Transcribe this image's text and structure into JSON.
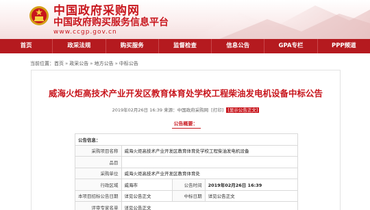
{
  "header": {
    "title": "中国政府采购网",
    "subtitle": "中国政府购买服务信息平台",
    "url": "www.ccgp.gov.cn",
    "emblem_icon": "national-emblem-icon",
    "brand_color": "#c8161d"
  },
  "nav": {
    "items": [
      {
        "label": "首页"
      },
      {
        "label": "政采法规"
      },
      {
        "label": "购买服务"
      },
      {
        "label": "监督检查"
      },
      {
        "label": "信息公告"
      },
      {
        "label": "GPA专栏"
      },
      {
        "label": "PPP频道"
      }
    ],
    "background": "#b51a1f"
  },
  "breadcrumb": {
    "prefix": "当前位置：",
    "items": [
      "首页",
      "政采公告",
      "地方公告",
      "中标公告"
    ],
    "separator": "»"
  },
  "article": {
    "title": "威海火炬高技术产业开发区教育体育处学校工程柴油发电机设备中标公告",
    "meta_date": "2019年02月26日 16:39",
    "meta_source": "来源：中国政府采购网",
    "print_label": "打印",
    "show_body_label": "显示公告正文",
    "summary_label": "公告概要："
  },
  "table": {
    "section_head": "公告信息：",
    "rows": {
      "project_name_label": "采购项目名称",
      "project_name_value": "威海火炬高技术产业开发区教育体育处学校工程柴油发电机设备",
      "item_label": "品目",
      "item_value": "",
      "buyer_label": "采购单位",
      "buyer_value": "威海火炬高技术产业开发区教育体育处",
      "region_label": "行政区域",
      "region_value": "威海市",
      "publish_time_label": "公告时间",
      "publish_time_value": "2019年02月26日 16:39",
      "bid_date_label": "本项目招标公告日期",
      "bid_date_value": "详见公告正文",
      "award_date_label": "中标日期",
      "award_date_value": "详见公告正文",
      "experts_label": "评审专家名单",
      "experts_value": "详见公告正文"
    }
  }
}
